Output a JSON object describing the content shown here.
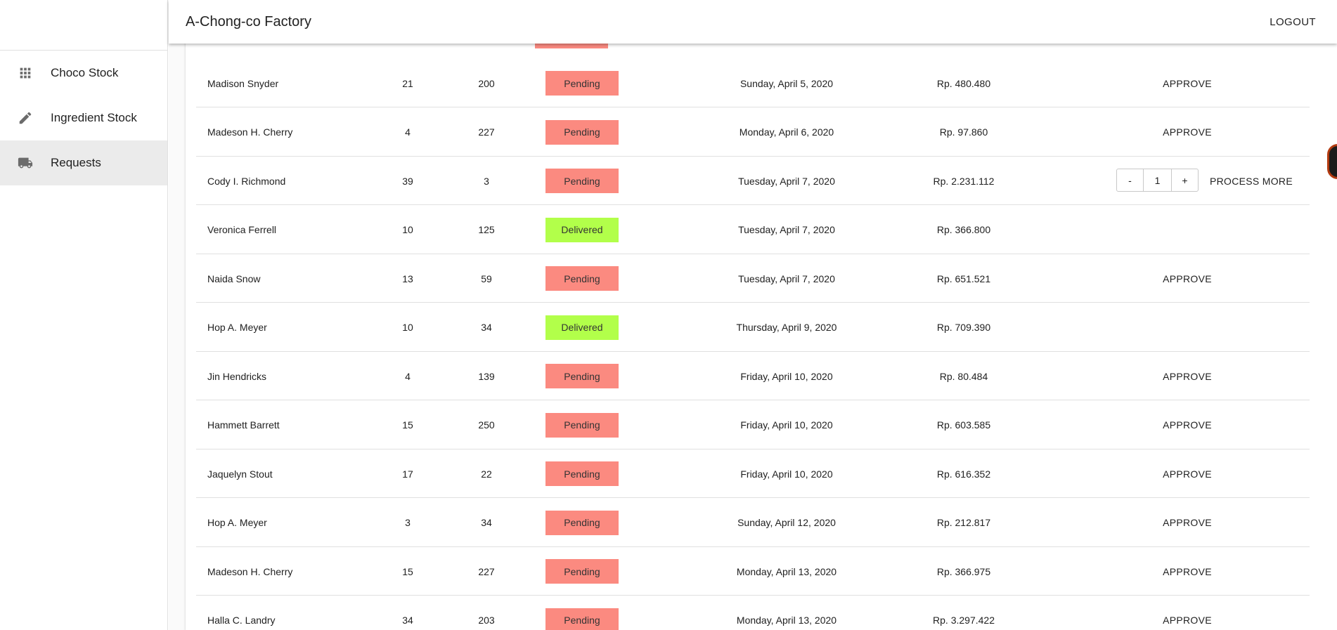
{
  "app": {
    "title": "A-Chong-co Factory",
    "logout_label": "LOGOUT"
  },
  "sidebar": {
    "items": [
      {
        "label": "Choco Stock",
        "icon": "grid-icon",
        "active": false
      },
      {
        "label": "Ingredient Stock",
        "icon": "pencil-icon",
        "active": false
      },
      {
        "label": "Requests",
        "icon": "truck-icon",
        "active": true
      }
    ]
  },
  "colors": {
    "pending": "#fb8a80",
    "delivered": "#b2ff4a"
  },
  "rows": [
    {
      "name": "Madison Snyder",
      "qty": "21",
      "id": "200",
      "status": "Pending",
      "date": "Sunday, April 5, 2020",
      "price": "Rp. 480.480",
      "action": "APPROVE"
    },
    {
      "name": "Madeson H. Cherry",
      "qty": "4",
      "id": "227",
      "status": "Pending",
      "date": "Monday, April 6, 2020",
      "price": "Rp. 97.860",
      "action": "APPROVE"
    },
    {
      "name": "Cody I. Richmond",
      "qty": "39",
      "id": "3",
      "status": "Pending",
      "date": "Tuesday, April 7, 2020",
      "price": "Rp. 2.231.112",
      "action": "",
      "stepper": {
        "minus": "-",
        "value": "1",
        "plus": "+",
        "process_label": "PROCESS MORE"
      }
    },
    {
      "name": "Veronica Ferrell",
      "qty": "10",
      "id": "125",
      "status": "Delivered",
      "date": "Tuesday, April 7, 2020",
      "price": "Rp. 366.800",
      "action": ""
    },
    {
      "name": "Naida Snow",
      "qty": "13",
      "id": "59",
      "status": "Pending",
      "date": "Tuesday, April 7, 2020",
      "price": "Rp. 651.521",
      "action": "APPROVE"
    },
    {
      "name": "Hop A. Meyer",
      "qty": "10",
      "id": "34",
      "status": "Delivered",
      "date": "Thursday, April 9, 2020",
      "price": "Rp. 709.390",
      "action": ""
    },
    {
      "name": "Jin Hendricks",
      "qty": "4",
      "id": "139",
      "status": "Pending",
      "date": "Friday, April 10, 2020",
      "price": "Rp. 80.484",
      "action": "APPROVE"
    },
    {
      "name": "Hammett Barrett",
      "qty": "15",
      "id": "250",
      "status": "Pending",
      "date": "Friday, April 10, 2020",
      "price": "Rp. 603.585",
      "action": "APPROVE"
    },
    {
      "name": "Jaquelyn Stout",
      "qty": "17",
      "id": "22",
      "status": "Pending",
      "date": "Friday, April 10, 2020",
      "price": "Rp. 616.352",
      "action": "APPROVE"
    },
    {
      "name": "Hop A. Meyer",
      "qty": "3",
      "id": "34",
      "status": "Pending",
      "date": "Sunday, April 12, 2020",
      "price": "Rp. 212.817",
      "action": "APPROVE"
    },
    {
      "name": "Madeson H. Cherry",
      "qty": "15",
      "id": "227",
      "status": "Pending",
      "date": "Monday, April 13, 2020",
      "price": "Rp. 366.975",
      "action": "APPROVE"
    },
    {
      "name": "Halla C. Landry",
      "qty": "34",
      "id": "203",
      "status": "Pending",
      "date": "Monday, April 13, 2020",
      "price": "Rp. 3.297.422",
      "action": "APPROVE"
    }
  ]
}
